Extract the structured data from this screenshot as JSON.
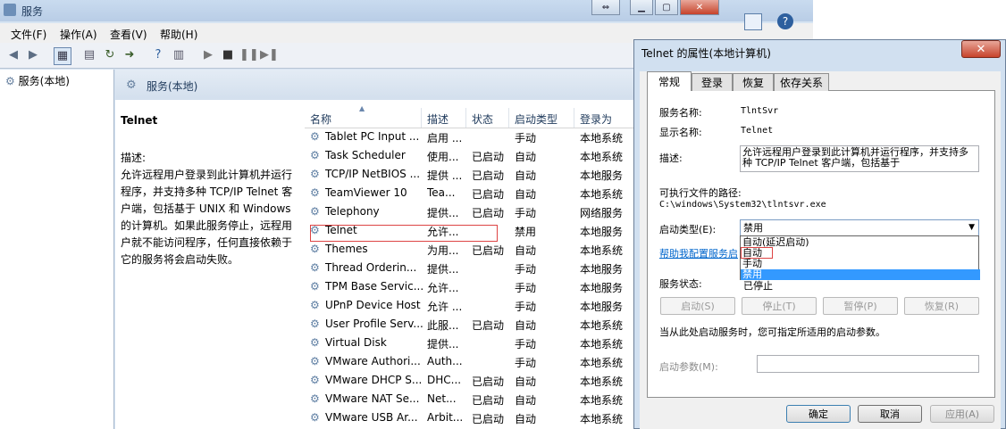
{
  "window": {
    "title": "服务"
  },
  "menu": [
    "文件(F)",
    "操作(A)",
    "查看(V)",
    "帮助(H)"
  ],
  "tree": {
    "node": "服务(本地)"
  },
  "band": {
    "title": "服务(本地)"
  },
  "desc": {
    "name": "Telnet",
    "label": "描述:",
    "text": "允许远程用户登录到此计算机并运行程序，并支持多种 TCP/IP Telnet 客户端，包括基于 UNIX 和 Windows 的计算机。如果此服务停止，远程用户就不能访问程序，任何直接依赖于它的服务将会启动失败。"
  },
  "columns": [
    "名称",
    "描述",
    "状态",
    "启动类型",
    "登录为"
  ],
  "rows": [
    [
      "Tablet PC Input ...",
      "启用 ...",
      "",
      "手动",
      "本地系统"
    ],
    [
      "Task Scheduler",
      "使用...",
      "已启动",
      "自动",
      "本地系统"
    ],
    [
      "TCP/IP NetBIOS ...",
      "提供 ...",
      "已启动",
      "自动",
      "本地服务"
    ],
    [
      "TeamViewer 10",
      "Tea...",
      "已启动",
      "自动",
      "本地系统"
    ],
    [
      "Telephony",
      "提供...",
      "已启动",
      "手动",
      "网络服务"
    ],
    [
      "Telnet",
      "允许...",
      "",
      "禁用",
      "本地服务"
    ],
    [
      "Themes",
      "为用...",
      "已启动",
      "自动",
      "本地系统"
    ],
    [
      "Thread Orderin...",
      "提供...",
      "",
      "手动",
      "本地服务"
    ],
    [
      "TPM Base Servic...",
      "允许...",
      "",
      "手动",
      "本地服务"
    ],
    [
      "UPnP Device Host",
      "允许 ...",
      "",
      "手动",
      "本地服务"
    ],
    [
      "User Profile Serv...",
      "此服...",
      "已启动",
      "自动",
      "本地系统"
    ],
    [
      "Virtual Disk",
      "提供...",
      "",
      "手动",
      "本地系统"
    ],
    [
      "VMware Authori...",
      "Auth...",
      "",
      "手动",
      "本地系统"
    ],
    [
      "VMware DHCP S...",
      "DHC...",
      "已启动",
      "自动",
      "本地系统"
    ],
    [
      "VMware NAT Se...",
      "Net...",
      "已启动",
      "自动",
      "本地系统"
    ],
    [
      "VMware USB Ar...",
      "Arbit...",
      "已启动",
      "自动",
      "本地系统"
    ]
  ],
  "dialog": {
    "title": "Telnet 的属性(本地计算机)",
    "tabs": [
      "常规",
      "登录",
      "恢复",
      "依存关系"
    ],
    "service_name_label": "服务名称:",
    "service_name": "TlntSvr",
    "display_name_label": "显示名称:",
    "display_name": "Telnet",
    "description_label": "描述:",
    "description": "允许远程用户登录到此计算机并运行程序，并支持多种 TCP/IP Telnet 客户端，包括基于",
    "path_label": "可执行文件的路径:",
    "path": "C:\\windows\\System32\\tlntsvr.exe",
    "startup_label": "启动类型(E):",
    "startup_value": "禁用",
    "options": [
      "自动(延迟启动)",
      "自动",
      "手动",
      "禁用"
    ],
    "help_link": "帮助我配置服务启",
    "status_label": "服务状态:",
    "status_value": "已停止",
    "buttons": [
      "启动(S)",
      "停止(T)",
      "暂停(P)",
      "恢复(R)"
    ],
    "params_hint": "当从此处启动服务时，您可指定所适用的启动参数。",
    "params_label": "启动参数(M):",
    "ok": "确定",
    "cancel": "取消",
    "apply": "应用(A)"
  },
  "colors": {
    "selection": "#3399ff",
    "highlight_border": "#dd4444"
  }
}
